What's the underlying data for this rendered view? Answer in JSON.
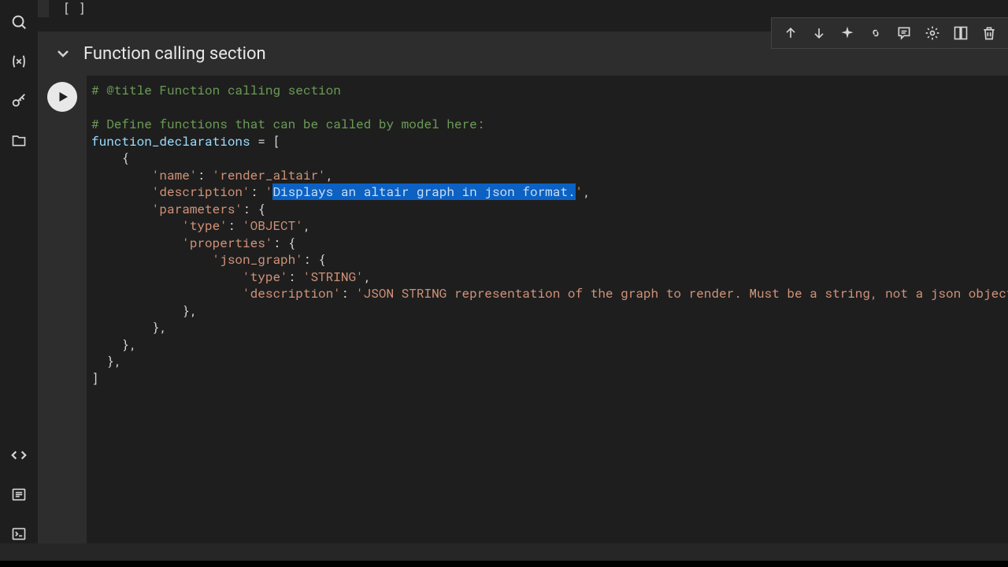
{
  "sidebar": {
    "icons": [
      "search",
      "variables",
      "secrets",
      "files",
      "code",
      "list",
      "terminal"
    ]
  },
  "toolbar": {
    "icons": [
      "arrow-up",
      "arrow-down",
      "sparkle",
      "link",
      "comment",
      "settings",
      "mirror",
      "delete"
    ]
  },
  "prev_fragment": "[ ]",
  "section": {
    "title": "Function calling section"
  },
  "code": {
    "line1_comment": "# @title Function calling section",
    "line3_comment": "# Define functions that can be called by model here:",
    "line4_var": "function_declarations",
    "line4_rest": " = [",
    "line5": "    {",
    "line6_key": "'name'",
    "line6_val": "'render_altair'",
    "line7_key": "'description'",
    "line7_q1": "'",
    "line7_sel": "Displays an altair graph in json format.",
    "line7_q2": "'",
    "line8_key": "'parameters'",
    "line8_rest": ": {",
    "line9_key": "'type'",
    "line9_val": "'OBJECT'",
    "line10_key": "'properties'",
    "line10_rest": ": {",
    "line11_key": "'json_graph'",
    "line11_rest": ": {",
    "line12_key": "'type'",
    "line12_val": "'STRING'",
    "line13_key": "'description'",
    "line13_val": "'JSON STRING representation of the graph to render. Must be a string, not a json object'",
    "line14": "            },",
    "line15": "        },",
    "line16": "    },",
    "line17": "  },",
    "line18": "]"
  }
}
